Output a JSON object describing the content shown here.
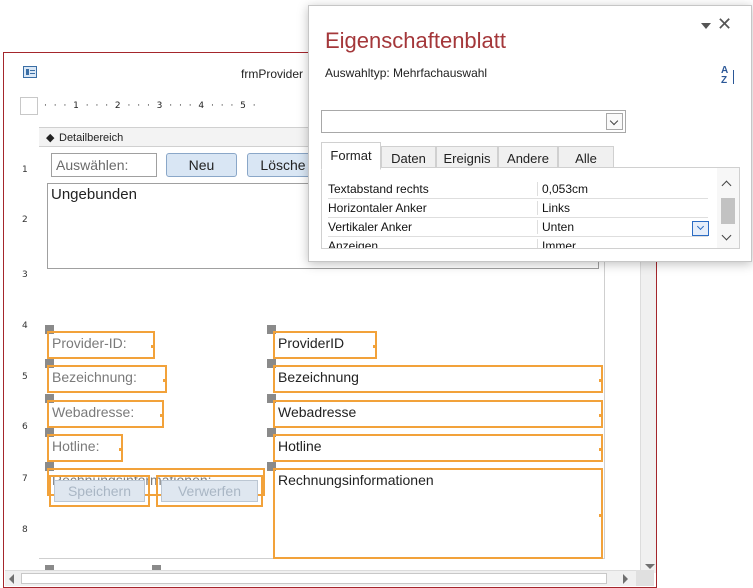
{
  "form_window": {
    "title": "frmProvider",
    "ruler_top": "· · · 1 · · · 2 · · · 3 · · · 4 · · · 5 ·",
    "ruler_left": [
      "1",
      "2",
      "3",
      "4",
      "5",
      "6",
      "7",
      "8"
    ],
    "section_label": "Detailbereich",
    "select_label": "Auswählen:",
    "btn_new": "Neu",
    "btn_delete": "Lösche",
    "listbox_text": "Ungebunden",
    "labels": [
      "Provider-ID:",
      "Bezeichnung:",
      "Webadresse:",
      "Hotline:",
      "Rechnungsinformationen:"
    ],
    "fields": [
      "ProviderID",
      "Bezeichnung",
      "Webadresse",
      "Hotline",
      "Rechnungsinformationen"
    ],
    "btn_save": "Speichern",
    "btn_discard": "Verwerfen"
  },
  "property_sheet": {
    "title": "Eigenschaftenblatt",
    "selection_type": "Auswahltyp:  Mehrfachauswahl",
    "sort_icon": "A-Z-sort-icon",
    "tabs": [
      "Format",
      "Daten",
      "Ereignis",
      "Andere",
      "Alle"
    ],
    "active_tab": "Format",
    "rows": [
      {
        "name": "Textabstand rechts",
        "value": "0,053cm"
      },
      {
        "name": "Horizontaler Anker",
        "value": "Links"
      },
      {
        "name": "Vertikaler Anker",
        "value": "Unten"
      },
      {
        "name": "Anzeigen",
        "value": "Immer"
      }
    ]
  },
  "colors": {
    "selection_orange": "#f2a23a",
    "title_red": "#a4373a",
    "window_border": "#a4262c"
  }
}
